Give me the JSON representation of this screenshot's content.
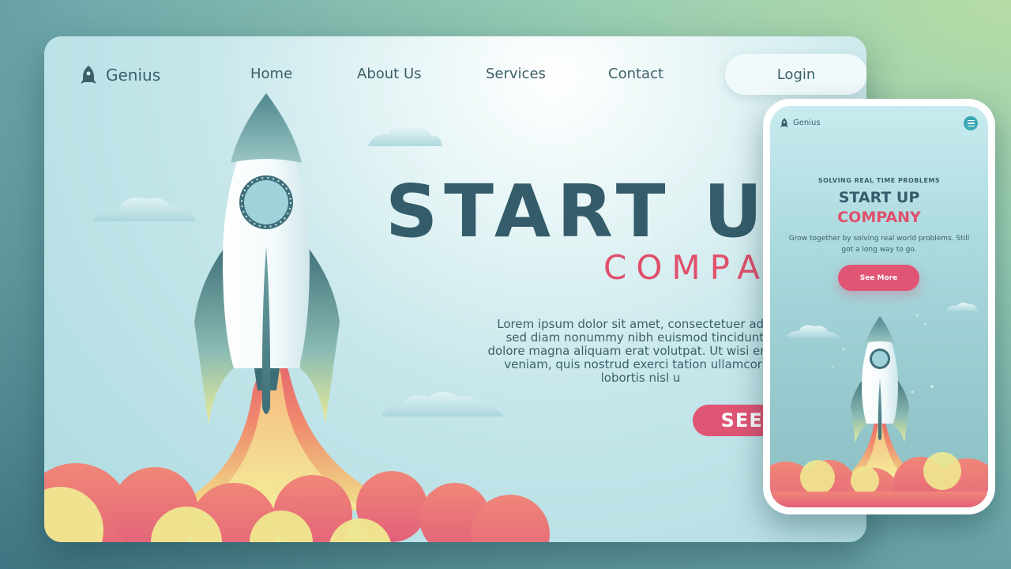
{
  "brand": {
    "name": "Genius"
  },
  "desktop": {
    "nav": {
      "home": "Home",
      "about": "About Us",
      "services": "Services",
      "contact": "Contact",
      "login": "Login"
    },
    "hero": {
      "title": "START U",
      "subtitle": "COMPAN",
      "body_lines": [
        "Lorem ipsum dolor sit amet, consectetuer adipis",
        "sed diam nonummy nibh euismod tincidunt u",
        "dolore magna aliquam erat volutpat. Ut wisi enim a",
        "veniam, quis nostrud exerci tation ullamcorpe",
        "lobortis nisl u"
      ],
      "cta": "SEE MO"
    }
  },
  "mobile": {
    "eyebrow": "SOLVING REAL TIME PROBLEMS",
    "title": "START UP",
    "subtitle": "COMPANY",
    "body_lines": [
      "Grow together by solving real world problems. Still",
      "got a long way to go."
    ],
    "cta": "See More"
  },
  "colors": {
    "accent": "#e05474",
    "heading": "#345c6b",
    "text": "#3c5f6a",
    "menu": "#3aa8b3"
  },
  "icons": {
    "logo": "rocket-icon",
    "mobile_menu": "hamburger-menu-icon"
  }
}
